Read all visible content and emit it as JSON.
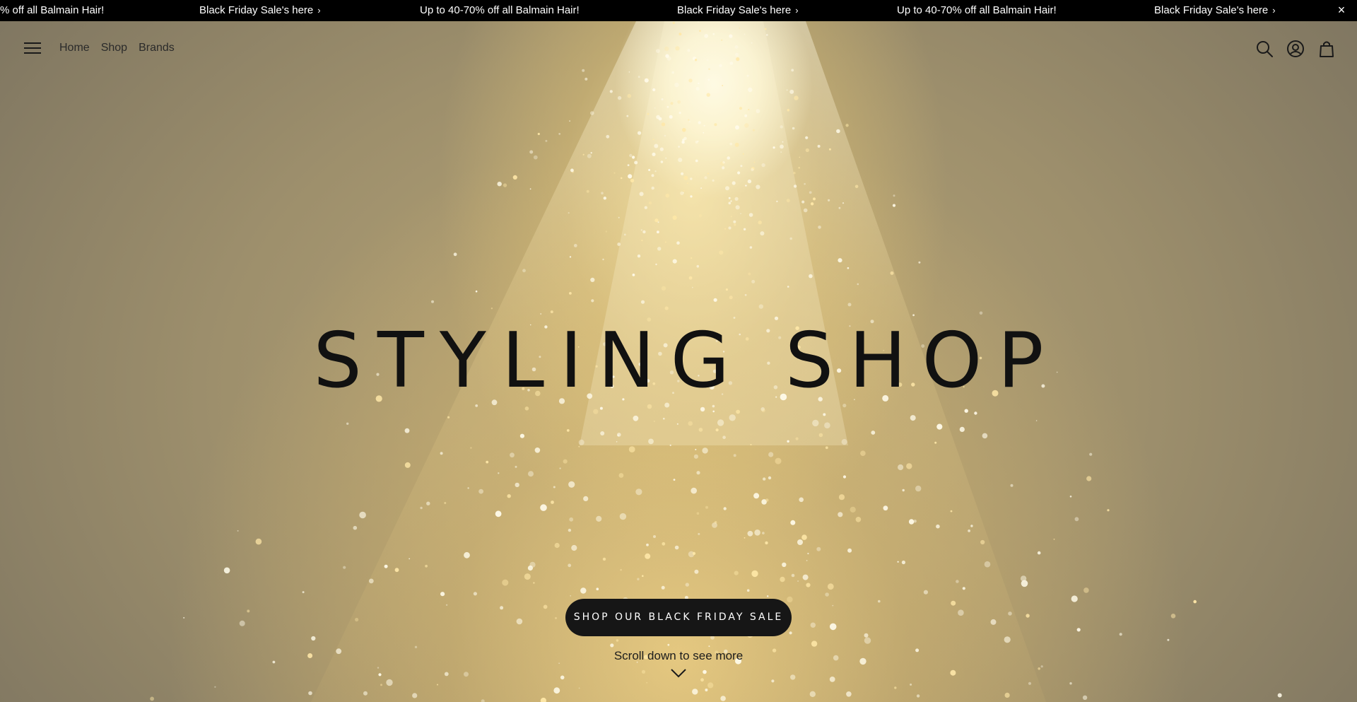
{
  "announcement": {
    "messages": [
      "% off all Balmain Hair!",
      "Black Friday Sale's here",
      "Up to 40-70% off all Balmain Hair!",
      "Black Friday Sale's here",
      "Up to 40-70% off all Balmain Hair!",
      "Black Friday Sale's here"
    ],
    "chevron": "›",
    "close_label": "×"
  },
  "header": {
    "nav": [
      "Home",
      "Shop",
      "Brands"
    ],
    "icons": [
      "search-icon",
      "account-icon",
      "cart-icon"
    ]
  },
  "hero": {
    "title": "STYLING SHOP",
    "cta_label": "SHOP OUR BLACK FRIDAY SALE",
    "scroll_hint": "Scroll down to see more"
  },
  "colors": {
    "announcement_bg": "#000000",
    "cta_bg": "#161616",
    "text_dark": "#111111"
  }
}
